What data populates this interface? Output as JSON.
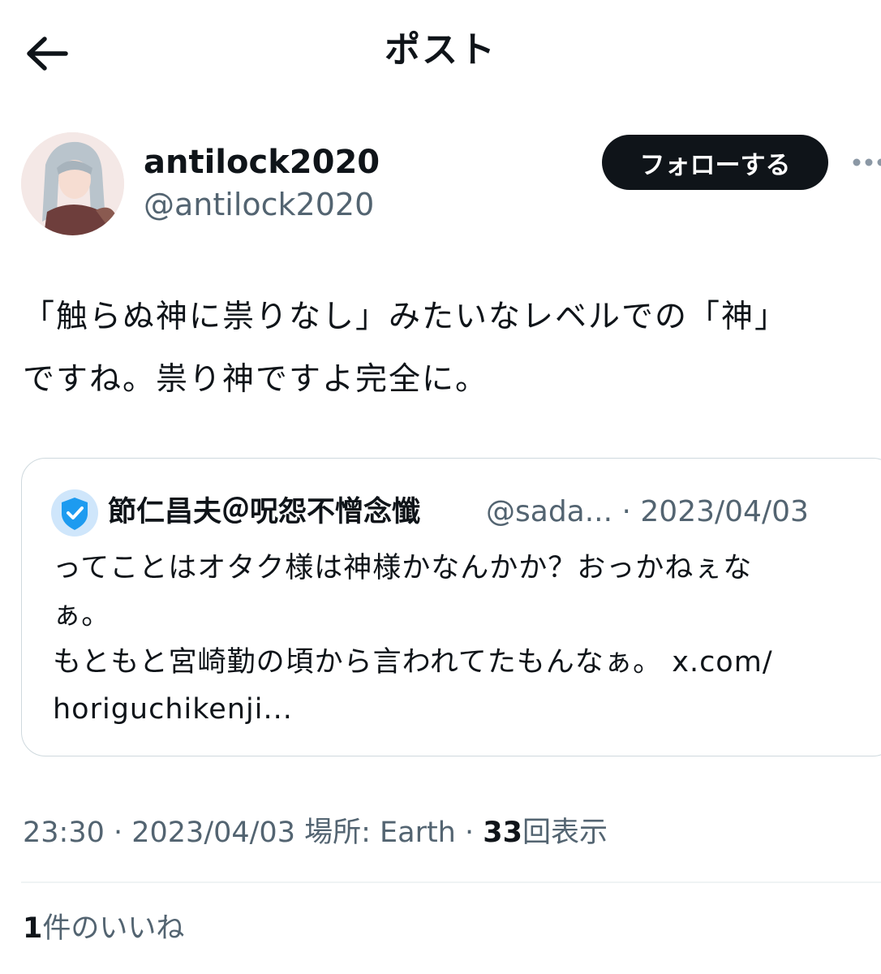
{
  "header": {
    "title": "ポスト",
    "back_icon": "arrow-left-icon"
  },
  "author": {
    "display_name": "antilock2020",
    "handle": "@antilock2020",
    "follow_label": "フォローする",
    "more_icon": "more-horizontal-icon"
  },
  "tweet": {
    "text": "「触らぬ神に祟りなし」みたいなレベルでの「神」\nですね。祟り神ですよ完全に。"
  },
  "quote": {
    "badge_icon": "verified-shield-icon",
    "name": "節仁昌夫＠呪怨不憎念懺",
    "meta": "@sada... · 2023/04/03",
    "text": "ってことはオタク様は神様かなんかか？おっかねぇな\nぁ。\nもともと宮崎勤の頃から言われてたもんなぁ。 x.com/\nhoriguchikenji..."
  },
  "meta": {
    "time_date_location": "23:30 · 2023/04/03 場所: Earth · ",
    "views_count": "33",
    "views_label": "回表示"
  },
  "likes": {
    "count": "1",
    "label": "件のいいね"
  },
  "colors": {
    "text_primary": "#0f1419",
    "text_secondary": "#536471",
    "border": "#cfd9de",
    "follow_bg": "#0f1419",
    "badge_blue": "#1d9bf0"
  }
}
